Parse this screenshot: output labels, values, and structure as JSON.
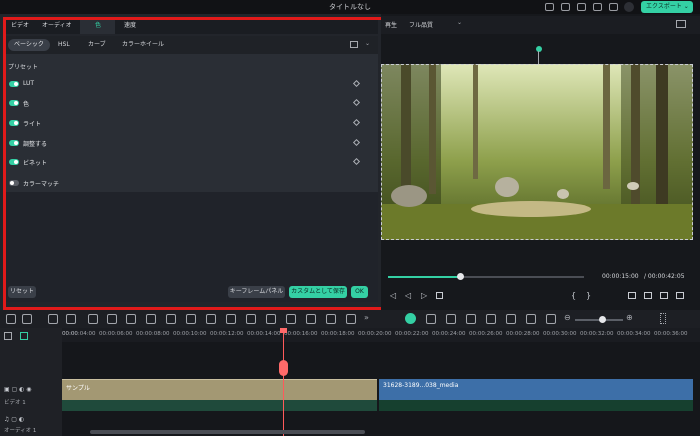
{
  "titlebar": {
    "title": "タイトルなし",
    "export_label": "エクスポート ⌄"
  },
  "tabs": [
    {
      "label": "ビデオ"
    },
    {
      "label": "オーディオ"
    },
    {
      "label": "色"
    },
    {
      "label": "速度"
    }
  ],
  "subtabs": [
    {
      "label": "ベーシック"
    },
    {
      "label": "HSL"
    },
    {
      "label": "カーブ"
    },
    {
      "label": "カラーホイール"
    }
  ],
  "presets_label": "プリセット",
  "rows": [
    {
      "label": "LUT",
      "enabled": true
    },
    {
      "label": "色",
      "enabled": true
    },
    {
      "label": "ライト",
      "enabled": true
    },
    {
      "label": "調整する",
      "enabled": true
    },
    {
      "label": "ビネット",
      "enabled": true
    },
    {
      "label": "カラーマッチ",
      "enabled": false
    }
  ],
  "buttons": {
    "reset": "リセット",
    "keyframe": "キーフレームパネル",
    "save_custom": "カスタムとして保存",
    "ok": "OK"
  },
  "player": {
    "mode": "再生",
    "quality": "フル品質",
    "current_time": "00:00:15:00",
    "total_time": "/ 00:00:42:05",
    "progress": 0.37
  },
  "ruler": [
    "00:00",
    "00:00:04:00",
    "00:00:06:00",
    "00:00:08:00",
    "00:00:10:00",
    "00:00:12:00",
    "00:00:14:00",
    "00:00:16:00",
    "00:00:18:00",
    "00:00:20:00",
    "00:00:22:00",
    "00:00:24:00",
    "00:00:26:00",
    "00:00:28:00",
    "00:00:30:00",
    "00:00:32:00",
    "00:00:34:00",
    "00:00:36:00"
  ],
  "tracks": {
    "video_label": "ビデオ 1",
    "audio_label": "オーディオ 1"
  },
  "clips": {
    "clip1": "サンプル",
    "clip2": "31628-3189...038_media"
  },
  "colors": {
    "accent": "#34d0a4",
    "highlight_border": "#e11a1a"
  }
}
